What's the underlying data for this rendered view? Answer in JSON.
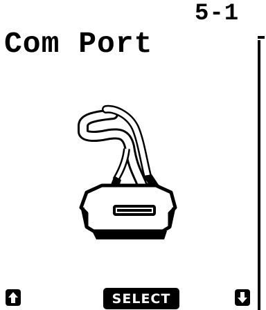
{
  "header": {
    "screen_id": "5-1",
    "title": "Com Port"
  },
  "illustration": {
    "icon": "serial-cable-connector-icon"
  },
  "softkeys": {
    "left_icon": "arrow-up-icon",
    "center_label": "SELECT",
    "right_icon": "arrow-down-icon"
  },
  "colors": {
    "foreground": "#000000",
    "background": "#ffffff"
  }
}
